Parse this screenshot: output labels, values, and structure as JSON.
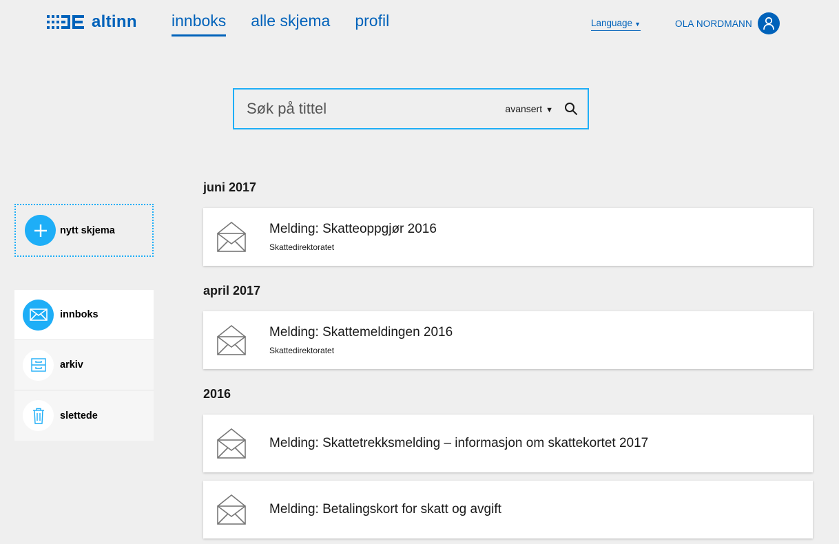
{
  "header": {
    "logo_text": "altinn",
    "nav": [
      {
        "label": "innboks",
        "active": true
      },
      {
        "label": "alle skjema",
        "active": false
      },
      {
        "label": "profil",
        "active": false
      }
    ],
    "language_label": "Language",
    "user_name": "OLA NORDMANN"
  },
  "search": {
    "placeholder": "Søk på tittel",
    "advanced_label": "avansert"
  },
  "sidebar": {
    "new_form_label": "nytt skjema",
    "items": [
      {
        "label": "innboks",
        "icon": "envelope-icon",
        "active": true
      },
      {
        "label": "arkiv",
        "icon": "archive-icon",
        "active": false
      },
      {
        "label": "slettede",
        "icon": "trash-icon",
        "active": false
      }
    ]
  },
  "messages": {
    "groups": [
      {
        "heading": "juni 2017",
        "items": [
          {
            "title": "Melding: Skatteoppgjør 2016",
            "sender": "Skattedirektoratet"
          }
        ]
      },
      {
        "heading": "april 2017",
        "items": [
          {
            "title": "Melding: Skattemeldingen 2016",
            "sender": "Skattedirektoratet"
          }
        ]
      },
      {
        "heading": "2016",
        "items": [
          {
            "title": "Melding: Skattetrekksmelding – informasjon om skattekortet 2017",
            "sender": ""
          },
          {
            "title": "Melding: Betalingskort for skatt og avgift",
            "sender": ""
          }
        ]
      }
    ]
  },
  "colors": {
    "brand_blue": "#0062ba",
    "accent_blue": "#1eaef7",
    "background": "#efefef"
  }
}
